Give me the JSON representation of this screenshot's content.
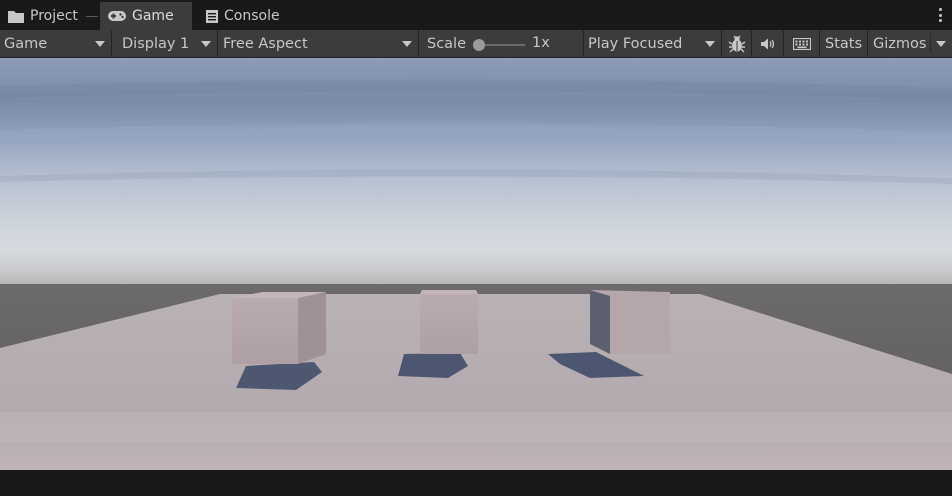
{
  "tabs": [
    {
      "label": "Project",
      "icon": "folder-icon",
      "active": false
    },
    {
      "label": "Game",
      "icon": "gamepad-icon",
      "active": true
    },
    {
      "label": "Console",
      "icon": "console-icon",
      "active": false
    }
  ],
  "toolbar": {
    "view_mode": "Game",
    "display": "Display 1",
    "aspect": "Free Aspect",
    "scale_label": "Scale",
    "scale_value": "1x",
    "play_mode": "Play Focused",
    "stats_label": "Stats",
    "gizmos_label": "Gizmos",
    "icons": [
      "bug-icon",
      "audio-mute-icon",
      "keyboard-icon"
    ]
  },
  "scene": {
    "objects": [
      "cube-left",
      "cube-middle",
      "cube-right"
    ],
    "colors": {
      "sky_top": "#8fa0bc",
      "horizon": "#d4d8de",
      "ground_far": "#5a5a5c",
      "floor": "#b7b0b4",
      "cube_face": "#b5a7ab",
      "shadow": "#4d5670"
    }
  }
}
